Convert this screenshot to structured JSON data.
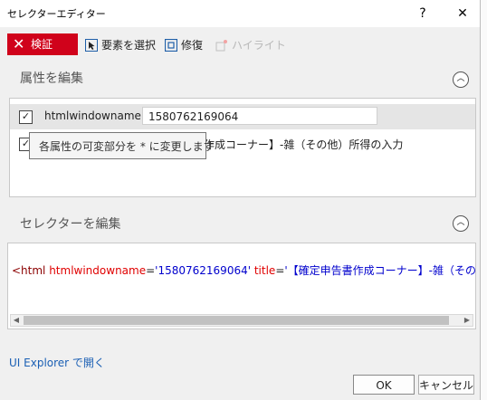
{
  "window": {
    "title": "セレクターエディター",
    "help": "?",
    "close": "✕"
  },
  "toolbar": {
    "validate_label": "検証",
    "select_element_label": "要素を選択",
    "repair_label": "修復",
    "highlight_label": "ハイライト"
  },
  "attributes_section": {
    "title": "属性を編集",
    "collapse_glyph": "︿",
    "rows": [
      {
        "checked": true,
        "name": "htmlwindowname",
        "value": "1580762169064"
      },
      {
        "checked": true,
        "text": "作成コーナー】-雑（その他）所得の入力"
      }
    ],
    "tooltip": "各属性の可変部分を * に変更します"
  },
  "selector_section": {
    "title": "セレクターを編集",
    "collapse_glyph": "︿",
    "selector": {
      "open": "<html ",
      "attr1": "htmlwindowname",
      "eq1": "=",
      "val1": "'1580762169064'",
      "attr2": " title",
      "eq2": "=",
      "val2": "'【確定申告書作成コーナー】-雑（その他）所得の入力"
    }
  },
  "footer": {
    "explorer_link": "UI Explorer で開く",
    "ok": "OK",
    "cancel": "キャンセル"
  },
  "colors": {
    "validate_bg": "#d0021b",
    "link": "#1a5fb4"
  }
}
